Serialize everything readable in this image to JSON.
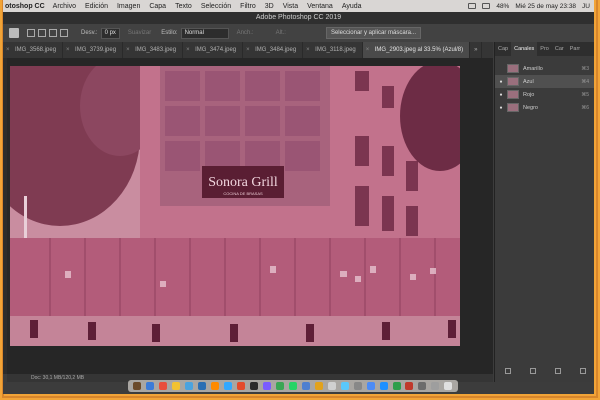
{
  "menubar": {
    "app_name": "otoshop CC",
    "items": [
      "Archivo",
      "Edición",
      "Imagen",
      "Capa",
      "Texto",
      "Selección",
      "Filtro",
      "3D",
      "Vista",
      "Ventana",
      "Ayuda"
    ],
    "battery": "48%",
    "clock": "Mié 25 de may 23:38",
    "user": "JU"
  },
  "titlebar": {
    "title": "Adobe Photoshop CC 2019"
  },
  "options": {
    "desv_label": "Desv.:",
    "desv_value": "0 px",
    "suavizar_label": "Suavizar",
    "estilo_label": "Estilo:",
    "estilo_value": "Normal",
    "anch_label": "Anch.:",
    "alt_label": "Alt.:",
    "select_mask_button": "Seleccionar y aplicar máscara..."
  },
  "tabs": [
    {
      "label": "IMG_3568.jpeg",
      "active": false
    },
    {
      "label": "IMG_3739.jpeg",
      "active": false
    },
    {
      "label": "IMG_3483.jpeg",
      "active": false
    },
    {
      "label": "IMG_3474.jpeg",
      "active": false
    },
    {
      "label": "IMG_3484.jpeg",
      "active": false
    },
    {
      "label": "IMG_3118.jpeg",
      "active": false
    },
    {
      "label": "IMG_2903.jpeg al 33.5% (Azul/8)",
      "active": true
    }
  ],
  "tabs_more": "»",
  "panel": {
    "tabs": [
      "Cap",
      "Canales",
      "Pro",
      "Car",
      "Parr"
    ],
    "active_tab": "Canales",
    "channels": [
      {
        "name": "Amarillo",
        "shortcut": "⌘3",
        "visible": false,
        "selected": false
      },
      {
        "name": "Azul",
        "shortcut": "⌘4",
        "visible": true,
        "selected": true
      },
      {
        "name": "Rojo",
        "shortcut": "⌘5",
        "visible": true,
        "selected": false
      },
      {
        "name": "Negro",
        "shortcut": "⌘6",
        "visible": true,
        "selected": false
      }
    ]
  },
  "photo": {
    "sign_text": "Sonora Grill",
    "sign_sub": "COCINA DE BRASAS"
  },
  "status": {
    "text": "Doc: 30,1 MB/120,2 MB"
  },
  "dock_colors": [
    "#6b4a2a",
    "#3b7bd8",
    "#e94e3c",
    "#f2c230",
    "#4aa3df",
    "#2b6fb3",
    "#ff8a00",
    "#31a8ff",
    "#e34b2c",
    "#2b2b2b",
    "#7a5cff",
    "#3aa655",
    "#25d366",
    "#4f7fd0",
    "#e2a21b",
    "#d0d0d0",
    "#5ac8fa",
    "#888888",
    "#4c8bf5",
    "#1e90ff",
    "#2c9e4b",
    "#c0392b",
    "#6c6c6c",
    "#9e9e9e",
    "#e0e0e0"
  ]
}
